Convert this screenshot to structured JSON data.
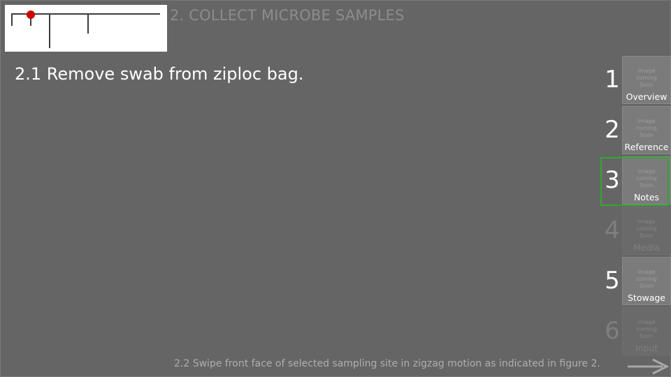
{
  "header": {
    "section_title": "2. COLLECT MICROBE SAMPLES"
  },
  "progress_map": {
    "current_position": "start"
  },
  "current_step": {
    "text": "2.1  Remove swab from ziploc bag."
  },
  "next_step": {
    "text": "2.2  Swipe front face of selected sampling site in zigzag motion as indicated in figure 2."
  },
  "tabs": [
    {
      "number": "1",
      "label": "Overview",
      "thumb_text": "Image\ncoming\nSoon",
      "state": "enabled"
    },
    {
      "number": "2",
      "label": "Reference",
      "thumb_text": "Image\ncoming\nSoon",
      "state": "enabled"
    },
    {
      "number": "3",
      "label": "Notes",
      "thumb_text": "Image\ncoming\nSoon",
      "state": "selected"
    },
    {
      "number": "4",
      "label": "Media",
      "thumb_text": "Image\ncoming\nSoon",
      "state": "disabled"
    },
    {
      "number": "5",
      "label": "Stowage",
      "thumb_text": "Image\ncoming\nSoon",
      "state": "enabled"
    },
    {
      "number": "6",
      "label": "Input",
      "thumb_text": "Image\ncoming\nSoon",
      "state": "disabled"
    }
  ],
  "icons": {
    "next_arrow": "arrow-right-icon",
    "progress_marker": "current-position-marker"
  },
  "colors": {
    "background": "#656565",
    "selected_border": "#2fa82f",
    "progress_marker": "#cc0000"
  }
}
